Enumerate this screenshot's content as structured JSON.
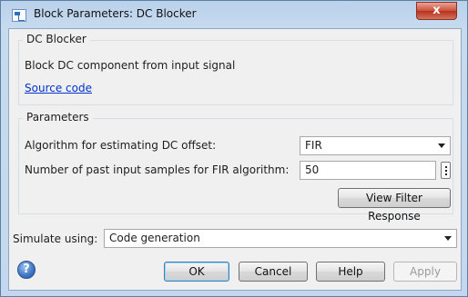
{
  "window": {
    "title": "Block Parameters: DC Blocker",
    "close_glyph": "x"
  },
  "block": {
    "group_title": "DC Blocker",
    "description": "Block DC component from input signal",
    "source_link": "Source code"
  },
  "parameters": {
    "group_title": "Parameters",
    "algorithm_label": "Algorithm for estimating DC offset:",
    "algorithm_value": "FIR",
    "samples_label": "Number of past input samples for FIR algorithm:",
    "samples_value": "50",
    "view_filter_button": "View Filter Response"
  },
  "simulate": {
    "label": "Simulate using:",
    "value": "Code generation"
  },
  "footer": {
    "help_icon_glyph": "?",
    "ok": "OK",
    "cancel": "Cancel",
    "help": "Help",
    "apply": "Apply"
  },
  "icons": {
    "app": "block-parameters-icon",
    "help": "help-icon",
    "kebab": "kebab-menu-icon",
    "dropdown": "chevron-down-icon"
  }
}
